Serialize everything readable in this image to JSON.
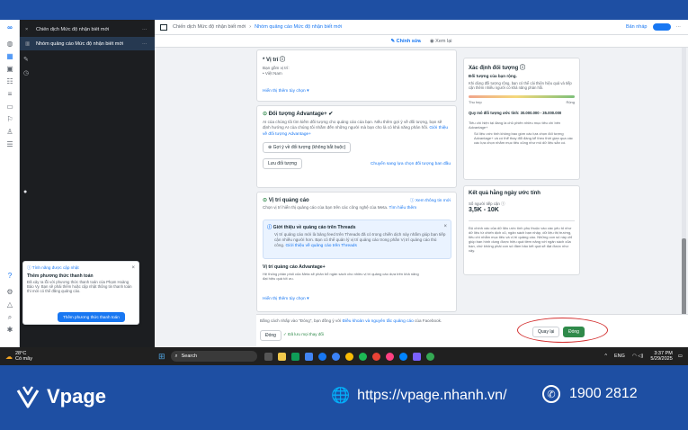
{
  "tree": {
    "items": [
      {
        "label": "Chiến dịch Mức độ nhận biết mới"
      },
      {
        "label": "Nhóm quảng cáo Mức độ nhận biết mới"
      }
    ]
  },
  "header": {
    "crumb_campaign": "Chiến dịch Mức độ nhận biết mới",
    "crumb_adset": "Nhóm quảng cáo Mức độ nhận biết mới",
    "draft": "Bản nháp",
    "edit": "Chỉnh sửa",
    "view": "Xem lại"
  },
  "location": {
    "title": "Vị trí",
    "sub": "Bạn gồm vị trí:",
    "value": "Việt Nam",
    "more": "Hiển thị thêm tùy chọn"
  },
  "audience": {
    "title": "Đối tượng Advantage+",
    "desc": "AI của chúng tôi tìm kiếm đối tượng cho quảng cáo của bạn. Nếu thêm gợi ý về đối tượng, bạn sẽ định hướng AI của chúng tôi nhắm đến những người mà bạn cho là có khả năng phản hồi.",
    "desc_link": "Giới thiệu về đối tượng Advantage+",
    "suggest": "Gợi ý về đối tượng (không bắt buộc)",
    "save": "Lưu đối tượng",
    "switch": "Chuyển sang lựa chọn đối tượng ban đầu"
  },
  "placement": {
    "title": "Vị trí quảng cáo",
    "learn": "Xem thông tin mới",
    "desc": "Chọn vị trí hiển thị quảng cáo của bạn trên các công nghệ của Meta.",
    "desc_link": "Tìm hiểu thêm",
    "threads_title": "Giới thiệu về quảng cáo trên Threads",
    "threads_desc": "Vị trí quảng cáo mới là bảng feed trên Threads đã có trong chiến dịch này nhằm giúp bạn tiếp cận nhiều người hơn. Bạn có thể quản lý vị trí quảng cáo trong phần Vị trí quảng cáo thủ công.",
    "threads_link": "Giới thiệu về quảng cáo trên Threads",
    "adv_title": "Vị trí quảng cáo Advantage+",
    "adv_desc": "Hệ thống phân phối của Meta sẽ phân bổ ngân sách cho nhiều vị trí quảng cáo dựa trên khả năng đạt hiệu quả tốt ưu.",
    "more": "Hiển thị thêm tùy chọn"
  },
  "define": {
    "title": "Xác định đối tượng",
    "sub": "Đối tượng của bạn rộng.",
    "desc": "Khi dùng đối tượng rộng, bạn có thể cải thiện hiệu quả và tiếp cận thêm nhiều người có khả năng phản hồi.",
    "specific": "Thu hẹp",
    "broad": "Rộng",
    "size": "Quy mô đối tượng ước tính: 30.000.000 - 35.000.000",
    "note": "Tiêu chí hiện tại đang là chủ phiên nhiều mục tiêu chí bên Advantage+",
    "note2": "Số liệu ước tính không bao gồm các lựa chọn đối tượng Advantage+ và có thể thay đổi đáng kể theo thời gian qua các các lựa chọn nhắm mục tiêu cũng như mô dữ liệu sẵn có."
  },
  "results": {
    "title": "Kết quả hằng ngày ước tính",
    "label": "Số người tiếp cận",
    "value": "3,5K - 10K",
    "desc": "Độ chính xác của dữ liệu ước tính phụ thuộc vào các yếu tố như dữ liệu từ chiến dịch cũ, ngân sách bạn nhập, dữ liệu thị trường, tiêu chí nhắm mục tiêu và vị trí quảng cáo. Những con số này chỉ giúp bạn hình dung được hiệu quả tiềm năng với ngân sách của bạn, chứ không phải con số đảm bảo kết quả sẽ đạt được như vậy."
  },
  "footer": {
    "terms": "Bằng cách nhấp vào \"Đóng\", bạn đồng ý với",
    "terms_link": "Điều khoản và nguyên tắc quảng cáo",
    "terms_end": "của Facebook.",
    "close": "Đóng",
    "saved": "Đã lưu mọi thay đổi",
    "back": "Quay lại",
    "done": "Đóng"
  },
  "notification": {
    "head": "Tính năng được cập nhật",
    "title": "Thêm phương thức thanh toán",
    "body": "Đã xảy ra lỗi với phương thức thanh toán của Phạm Hoàng Bảo Vy. Bạn sẽ phải thêm hoặc cập nhật thông tin thanh toán thì mới có thể đăng quảng cáo.",
    "button": "Thêm phương thức thanh toán"
  },
  "taskbar": {
    "temp": "28°C",
    "weather": "Có mây",
    "search": "Search",
    "lang": "ENG",
    "time": "3:37 PM",
    "date": "5/29/2025"
  },
  "brand": {
    "name": "Vpage",
    "url": "https://vpage.nhanh.vn/",
    "phone": "1900 2812"
  },
  "colors": {
    "accent": "#1877f2",
    "band": "#1e4fa3",
    "done": "#2f8a4a",
    "highlight": "#d32f2f"
  }
}
